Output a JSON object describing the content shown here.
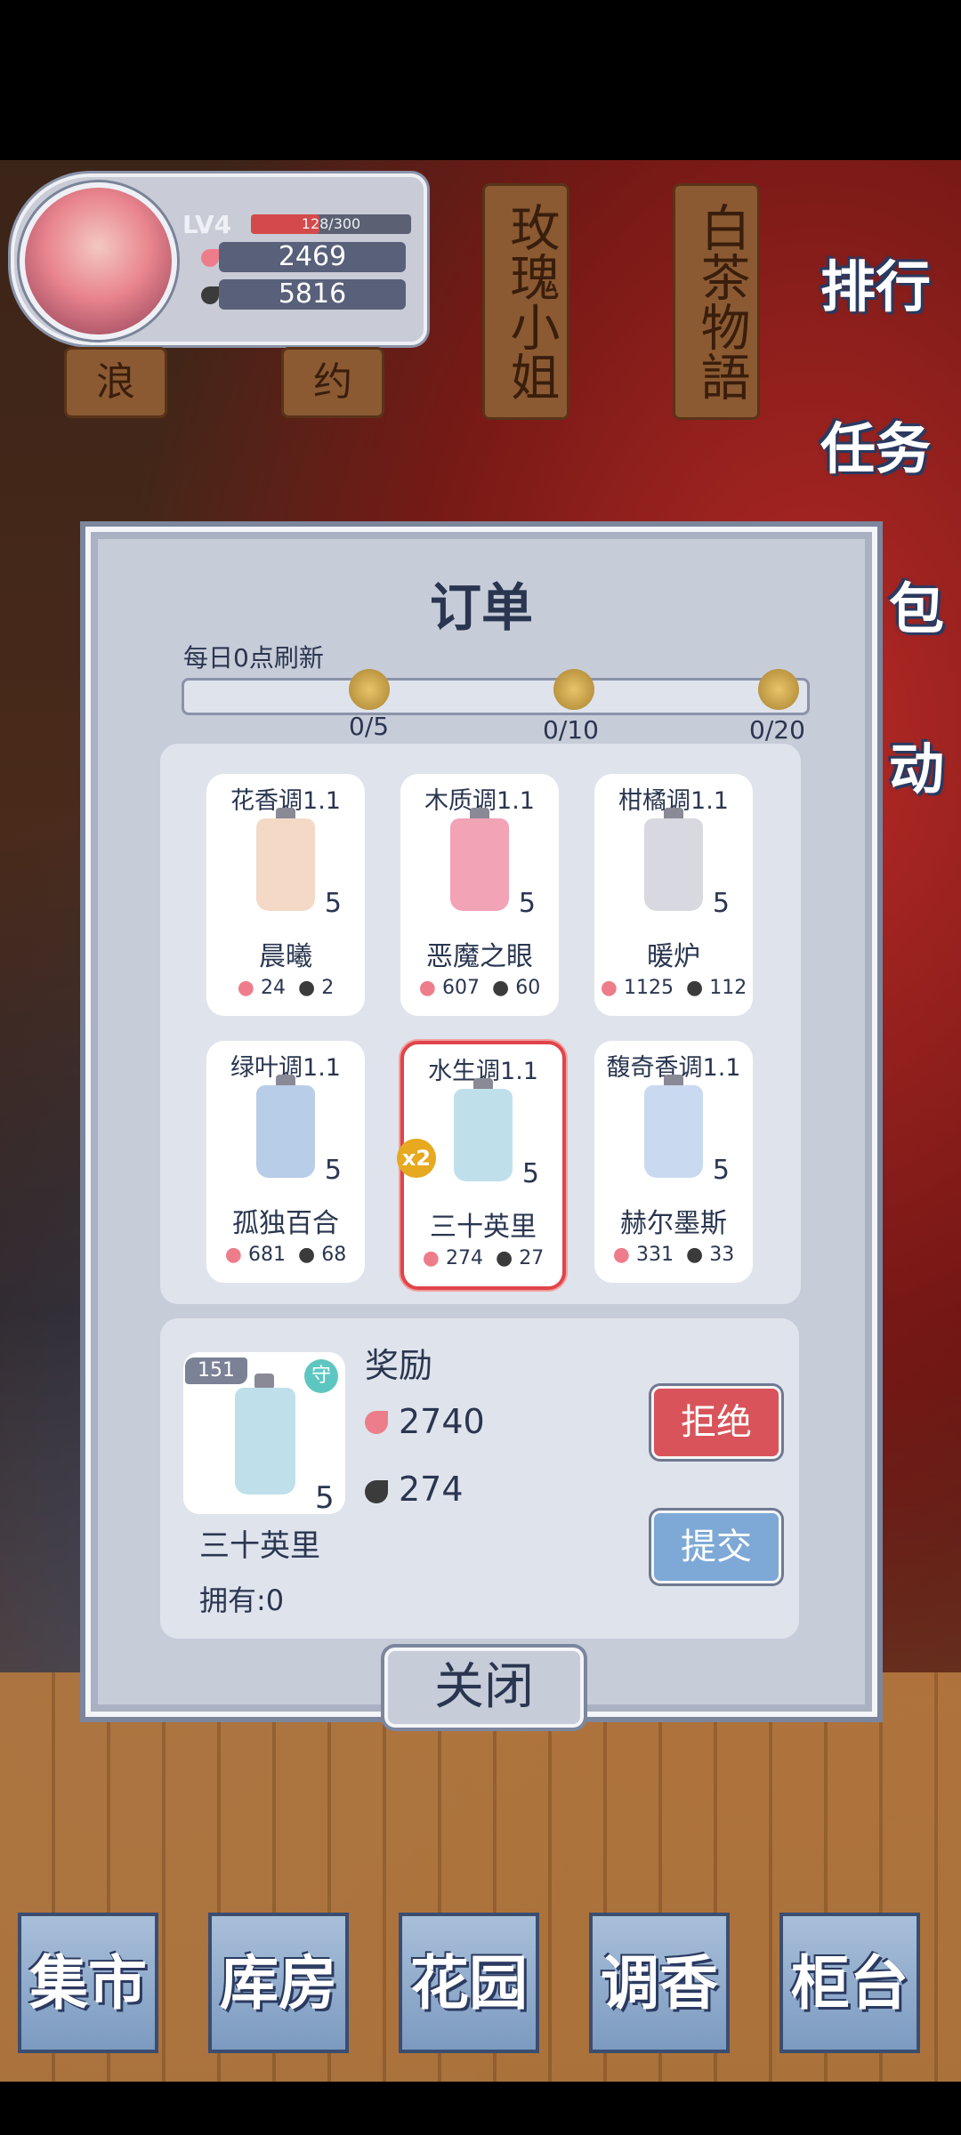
{
  "profile": {
    "level": "LV4",
    "exp": "128/300",
    "exp_fraction": 0.427,
    "petals": "2469",
    "leaves": "5816"
  },
  "tags": [
    "玫瑰小姐",
    "白茶物語",
    "浪",
    "约"
  ],
  "side_menu": [
    {
      "label": "排行",
      "icon": "ranking-icon"
    },
    {
      "label": "任务",
      "icon": "task-icon"
    },
    {
      "label": "包",
      "icon": "bag-icon"
    },
    {
      "label": "动",
      "icon": "event-icon"
    }
  ],
  "modal": {
    "title": "订单",
    "refresh_note": "每日0点刷新",
    "progress": {
      "fraction": 0,
      "milestones": [
        "0/5",
        "0/10",
        "0/20"
      ]
    },
    "orders": [
      {
        "type": "花香调1.1",
        "name": "晨曦",
        "count": "5",
        "petals": "24",
        "leaves": "2",
        "bottle": "#f4d9c6",
        "selected": false
      },
      {
        "type": "木质调1.1",
        "name": "恶魔之眼",
        "count": "5",
        "petals": "607",
        "leaves": "60",
        "bottle": "#f2a3b6",
        "selected": false
      },
      {
        "type": "柑橘调1.1",
        "name": "暖炉",
        "count": "5",
        "petals": "1125",
        "leaves": "112",
        "bottle": "#d8d8e0",
        "selected": false
      },
      {
        "type": "绿叶调1.1",
        "name": "孤独百合",
        "count": "5",
        "petals": "681",
        "leaves": "68",
        "bottle": "#b8cde8",
        "selected": false
      },
      {
        "type": "水生调1.1",
        "name": "三十英里",
        "count": "5",
        "petals": "274",
        "leaves": "27",
        "bottle": "#bfe0ea",
        "selected": true,
        "badge": "x2"
      },
      {
        "type": "馥奇香调1.1",
        "name": "赫尔墨斯",
        "count": "5",
        "petals": "331",
        "leaves": "33",
        "bottle": "#c9d9f0",
        "selected": false
      }
    ],
    "detail": {
      "id": "151",
      "type_badge": "守",
      "count": "5",
      "name": "三十英里",
      "owned": "拥有:0",
      "reward_label": "奖励",
      "reward_petals": "2740",
      "reward_leaves": "274",
      "reject": "拒绝",
      "submit": "提交"
    },
    "close": "关闭"
  },
  "bottom_nav": [
    "集市",
    "库房",
    "花园",
    "调香",
    "柜台"
  ],
  "colors": {
    "petal": "#ee7d8c",
    "leaf": "#3b3b3b",
    "reject": "#d8545a",
    "submit": "#7ea9d6",
    "selected_border": "#e0444a"
  }
}
